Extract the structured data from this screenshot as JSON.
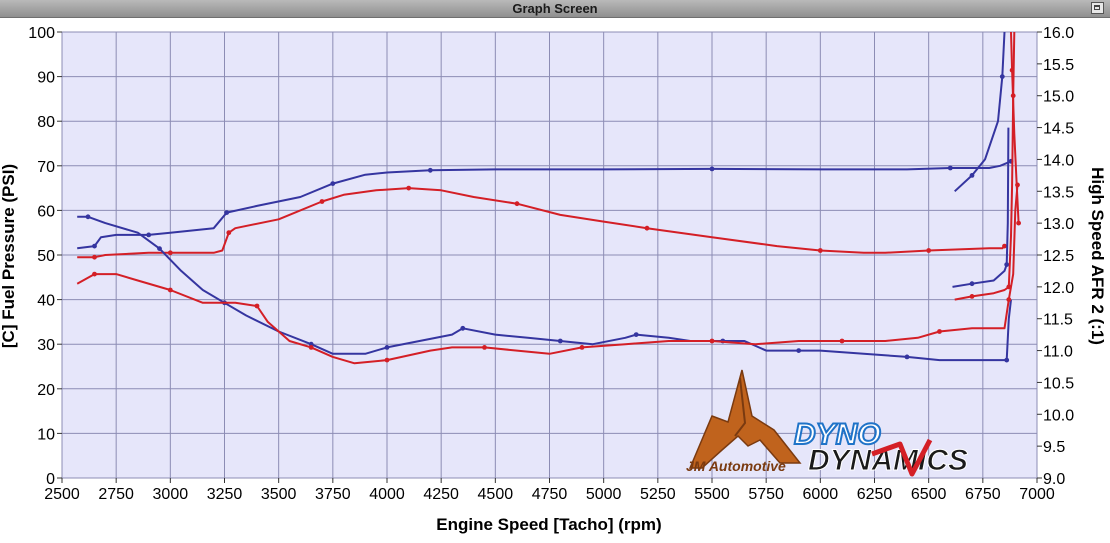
{
  "window": {
    "title": "Graph Screen"
  },
  "chart_data": {
    "type": "line",
    "xlabel": "Engine Speed [Tacho] (rpm)",
    "ylabel_left": "[C] Fuel Pressure (PSI)",
    "ylabel_right": "High Speed AFR 2 (:1)",
    "xlim": [
      2500,
      7000
    ],
    "ylim_left": [
      0,
      100
    ],
    "ylim_right": [
      9.0,
      16.0
    ],
    "x_ticks": [
      2500,
      2750,
      3000,
      3250,
      3500,
      3750,
      4000,
      4250,
      4500,
      4750,
      5000,
      5250,
      5500,
      5750,
      6000,
      6250,
      6500,
      6750,
      7000
    ],
    "y_left_ticks": [
      0,
      10,
      20,
      30,
      40,
      50,
      60,
      70,
      80,
      90,
      100
    ],
    "y_right_ticks": [
      "9.0",
      "9.5",
      "10.0",
      "10.5",
      "11.0",
      "11.5",
      "12.0",
      "12.5",
      "13.0",
      "13.5",
      "14.0",
      "14.5",
      "15.0",
      "15.5",
      "16.0"
    ],
    "grid": true,
    "plot_background": "#e6e6fa",
    "series": [
      {
        "axis": "left",
        "color": "#3535a0",
        "points": [
          [
            2570,
            51.5
          ],
          [
            2650,
            52
          ],
          [
            2680,
            54
          ],
          [
            2750,
            54.5
          ],
          [
            2900,
            54.5
          ],
          [
            3000,
            55
          ],
          [
            3200,
            56
          ],
          [
            3260,
            59.5
          ],
          [
            3400,
            61
          ],
          [
            3600,
            63
          ],
          [
            3750,
            66
          ],
          [
            3900,
            68
          ],
          [
            4000,
            68.5
          ],
          [
            4200,
            69
          ],
          [
            4500,
            69.2
          ],
          [
            5000,
            69.2
          ],
          [
            5500,
            69.3
          ],
          [
            6000,
            69.2
          ],
          [
            6400,
            69.2
          ],
          [
            6600,
            69.5
          ],
          [
            6780,
            69.5
          ],
          [
            6830,
            70
          ],
          [
            6880,
            71
          ]
        ]
      },
      {
        "axis": "left",
        "color": "#d41f26",
        "points": [
          [
            2570,
            49.5
          ],
          [
            2650,
            49.5
          ],
          [
            2700,
            50
          ],
          [
            2900,
            50.5
          ],
          [
            3000,
            50.5
          ],
          [
            3200,
            50.5
          ],
          [
            3240,
            51
          ],
          [
            3270,
            55
          ],
          [
            3300,
            56
          ],
          [
            3500,
            58
          ],
          [
            3700,
            62
          ],
          [
            3800,
            63.5
          ],
          [
            3950,
            64.5
          ],
          [
            4100,
            65
          ],
          [
            4250,
            64.5
          ],
          [
            4400,
            63
          ],
          [
            4600,
            61.5
          ],
          [
            4800,
            59
          ],
          [
            5000,
            57.5
          ],
          [
            5200,
            56
          ],
          [
            5500,
            54
          ],
          [
            5800,
            52
          ],
          [
            6000,
            51
          ],
          [
            6200,
            50.5
          ],
          [
            6300,
            50.5
          ],
          [
            6500,
            51
          ],
          [
            6780,
            51.5
          ],
          [
            6840,
            51.5
          ],
          [
            6850,
            52
          ]
        ]
      },
      {
        "axis": "right",
        "color": "#3535a0",
        "points": [
          [
            2570,
            13.1
          ],
          [
            2620,
            13.1
          ],
          [
            2700,
            13.0
          ],
          [
            2850,
            12.85
          ],
          [
            2950,
            12.6
          ],
          [
            3050,
            12.25
          ],
          [
            3150,
            11.95
          ],
          [
            3250,
            11.75
          ],
          [
            3350,
            11.55
          ],
          [
            3500,
            11.3
          ],
          [
            3650,
            11.1
          ],
          [
            3750,
            10.95
          ],
          [
            3900,
            10.95
          ],
          [
            4000,
            11.05
          ],
          [
            4150,
            11.15
          ],
          [
            4300,
            11.25
          ],
          [
            4350,
            11.35
          ],
          [
            4500,
            11.25
          ],
          [
            4650,
            11.2
          ],
          [
            4800,
            11.15
          ],
          [
            4950,
            11.1
          ],
          [
            5100,
            11.2
          ],
          [
            5150,
            11.25
          ],
          [
            5300,
            11.2
          ],
          [
            5400,
            11.15
          ],
          [
            5550,
            11.15
          ],
          [
            5650,
            11.15
          ],
          [
            5750,
            11.0
          ],
          [
            5900,
            11.0
          ],
          [
            6000,
            11.0
          ],
          [
            6200,
            10.95
          ],
          [
            6400,
            10.9
          ],
          [
            6550,
            10.85
          ],
          [
            6700,
            10.85
          ],
          [
            6860,
            10.85
          ],
          [
            6870,
            11.5
          ],
          [
            6880,
            11.8
          ]
        ]
      },
      {
        "axis": "right",
        "color": "#d41f26",
        "points": [
          [
            2570,
            12.05
          ],
          [
            2650,
            12.2
          ],
          [
            2750,
            12.2
          ],
          [
            2850,
            12.1
          ],
          [
            3000,
            11.95
          ],
          [
            3150,
            11.75
          ],
          [
            3300,
            11.75
          ],
          [
            3400,
            11.7
          ],
          [
            3450,
            11.45
          ],
          [
            3550,
            11.15
          ],
          [
            3650,
            11.05
          ],
          [
            3750,
            10.9
          ],
          [
            3850,
            10.8
          ],
          [
            4000,
            10.85
          ],
          [
            4200,
            11.0
          ],
          [
            4300,
            11.05
          ],
          [
            4450,
            11.05
          ],
          [
            4600,
            11.0
          ],
          [
            4750,
            10.95
          ],
          [
            4900,
            11.05
          ],
          [
            5100,
            11.1
          ],
          [
            5300,
            11.15
          ],
          [
            5500,
            11.15
          ],
          [
            5700,
            11.1
          ],
          [
            5900,
            11.15
          ],
          [
            6100,
            11.15
          ],
          [
            6300,
            11.15
          ],
          [
            6450,
            11.2
          ],
          [
            6550,
            11.3
          ],
          [
            6700,
            11.35
          ],
          [
            6850,
            11.35
          ],
          [
            6870,
            11.8
          ],
          [
            6890,
            12.2
          ],
          [
            6900,
            13.2
          ],
          [
            6910,
            13.6
          ]
        ]
      },
      {
        "axis": "right",
        "color": "#3535a0",
        "points": [
          [
            6620,
            13.5
          ],
          [
            6700,
            13.75
          ],
          [
            6760,
            14.0
          ],
          [
            6820,
            14.6
          ],
          [
            6840,
            15.3
          ],
          [
            6850,
            16.0
          ]
        ]
      },
      {
        "axis": "right",
        "color": "#3535a0",
        "points": [
          [
            6610,
            12.0
          ],
          [
            6700,
            12.05
          ],
          [
            6800,
            12.1
          ],
          [
            6850,
            12.25
          ],
          [
            6860,
            12.35
          ],
          [
            6865,
            13.0
          ],
          [
            6868,
            14.5
          ]
        ]
      },
      {
        "axis": "right",
        "color": "#d41f26",
        "points": [
          [
            6620,
            11.8
          ],
          [
            6700,
            11.85
          ],
          [
            6800,
            11.9
          ],
          [
            6850,
            11.95
          ],
          [
            6870,
            12.0
          ],
          [
            6880,
            12.8
          ],
          [
            6885,
            13.6
          ],
          [
            6890,
            15.0
          ],
          [
            6895,
            16.0
          ]
        ]
      },
      {
        "axis": "right",
        "color": "#d41f26",
        "points": [
          [
            6880,
            16.0
          ],
          [
            6885,
            15.4
          ],
          [
            6895,
            14.4
          ],
          [
            6905,
            13.7
          ],
          [
            6915,
            13.0
          ]
        ]
      }
    ],
    "logo_text": [
      "JM Automotive",
      "DYNO",
      "DYNAMICS"
    ]
  }
}
